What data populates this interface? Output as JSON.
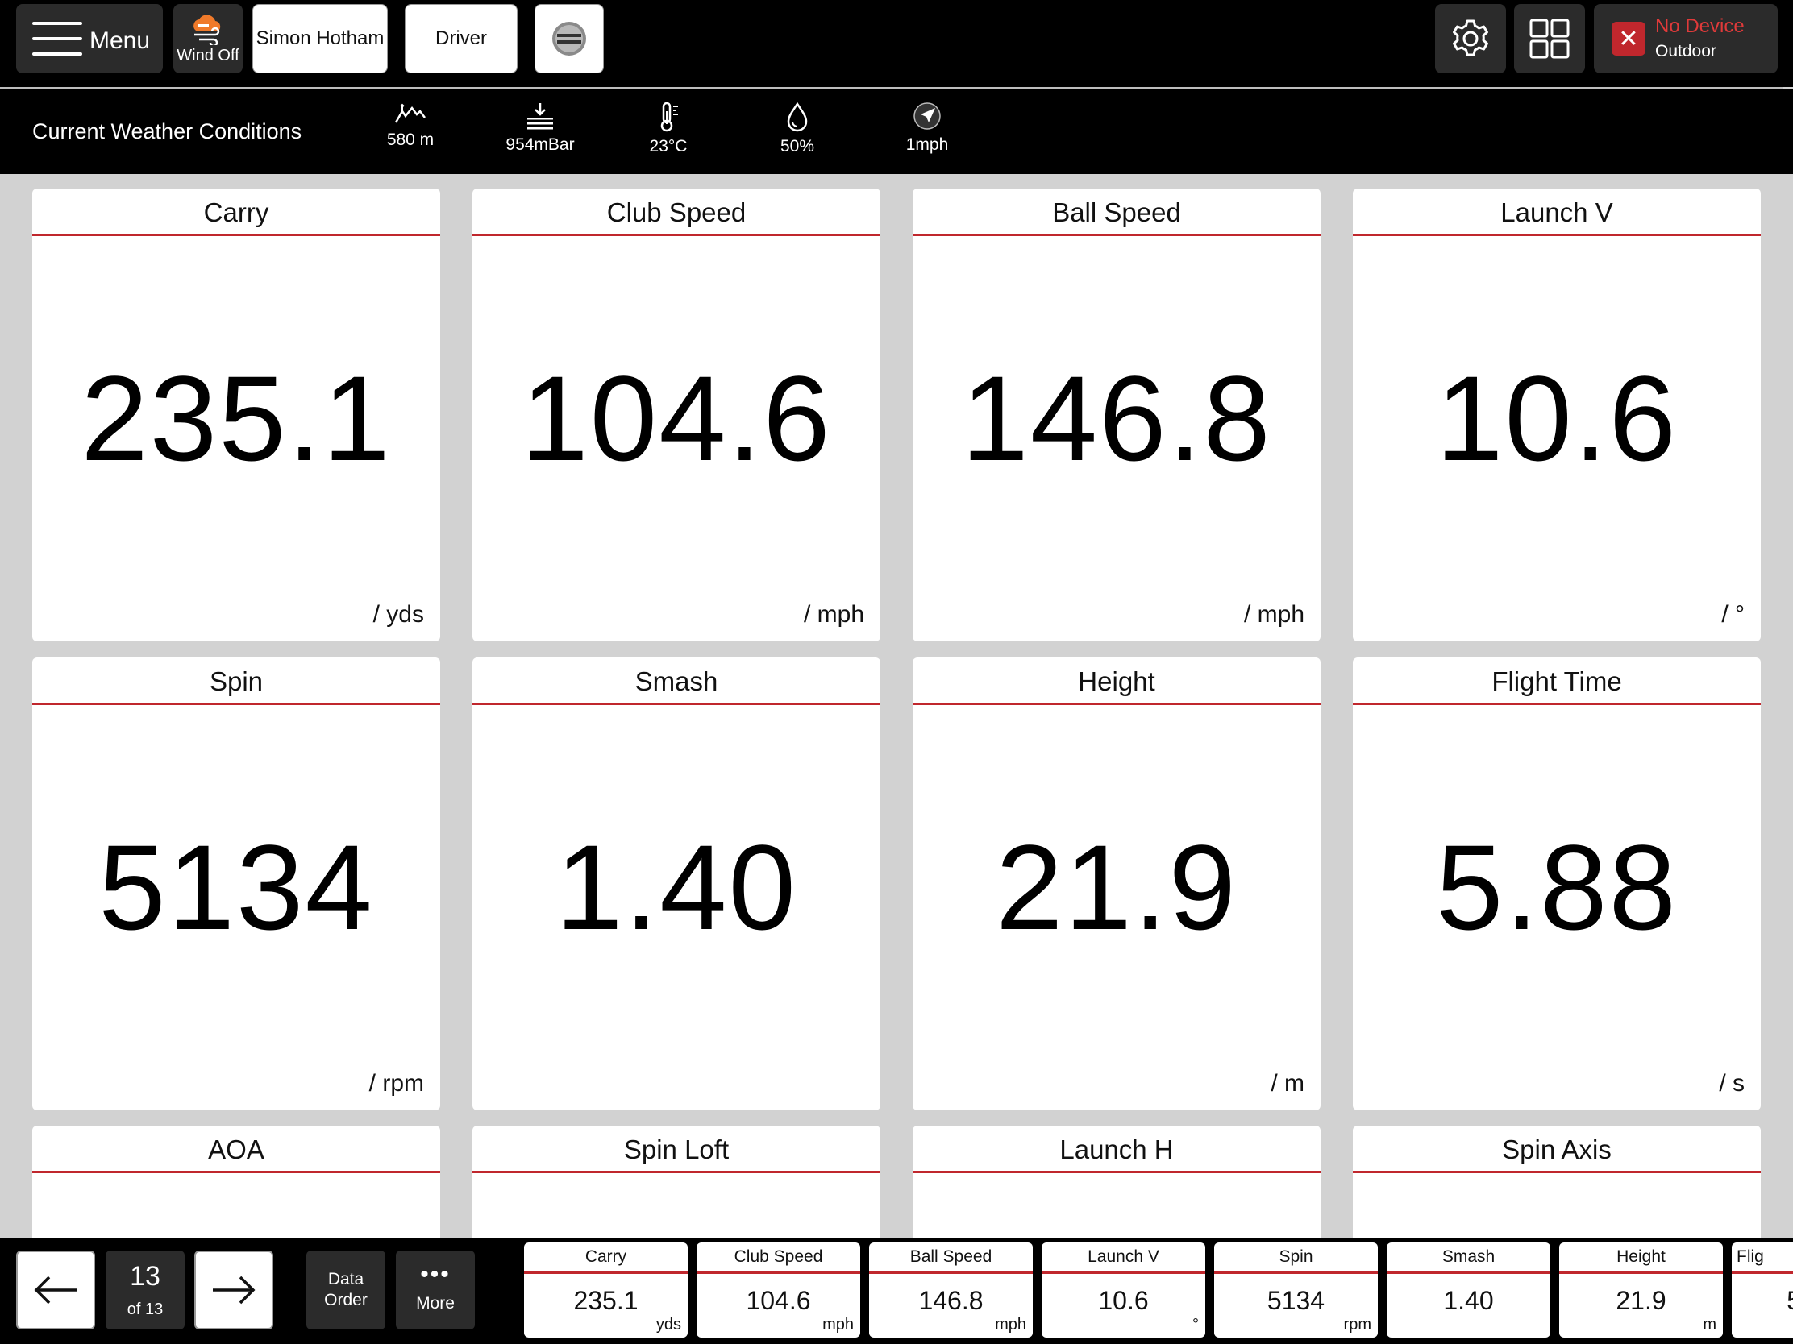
{
  "toolbar": {
    "menu_label": "Menu",
    "wind_label": "Wind Off",
    "player_name": "Simon Hotham",
    "club": "Driver",
    "device_status": "No Device",
    "device_mode": "Outdoor",
    "icons": [
      "hamburger-icon",
      "wind-cloud-icon",
      "golf-ball-icon",
      "gear-icon",
      "grid-layout-icon",
      "close-icon"
    ]
  },
  "weather": {
    "title": "Current Weather Conditions",
    "altitude": "580 m",
    "pressure": "954mBar",
    "temperature": "23°C",
    "humidity": "50%",
    "wind": "1mph"
  },
  "metrics": [
    {
      "label": "Carry",
      "value": "235.1",
      "unit": "/ yds"
    },
    {
      "label": "Club Speed",
      "value": "104.6",
      "unit": "/ mph"
    },
    {
      "label": "Ball Speed",
      "value": "146.8",
      "unit": "/ mph"
    },
    {
      "label": "Launch V",
      "value": "10.6",
      "unit": "/ °"
    },
    {
      "label": "Spin",
      "value": "5134",
      "unit": "/ rpm"
    },
    {
      "label": "Smash",
      "value": "1.40",
      "unit": ""
    },
    {
      "label": "Height",
      "value": "21.9",
      "unit": "/ m"
    },
    {
      "label": "Flight Time",
      "value": "5.88",
      "unit": "/ s"
    },
    {
      "label": "AOA"
    },
    {
      "label": "Spin Loft"
    },
    {
      "label": "Launch H"
    },
    {
      "label": "Spin Axis"
    }
  ],
  "bottom": {
    "page_current": "13",
    "page_total": "of 13",
    "data_order_line1": "Data",
    "data_order_line2": "Order",
    "more_label": "More",
    "summary": [
      {
        "label": "Carry",
        "value": "235.1",
        "unit": "yds"
      },
      {
        "label": "Club Speed",
        "value": "104.6",
        "unit": "mph"
      },
      {
        "label": "Ball Speed",
        "value": "146.8",
        "unit": "mph"
      },
      {
        "label": "Launch V",
        "value": "10.6",
        "unit": "°"
      },
      {
        "label": "Spin",
        "value": "5134",
        "unit": "rpm"
      },
      {
        "label": "Smash",
        "value": "1.40",
        "unit": ""
      },
      {
        "label": "Height",
        "value": "21.9",
        "unit": "m"
      },
      {
        "label": "Flig",
        "value": "5",
        "unit": ""
      }
    ]
  },
  "colors": {
    "accent": "#c0272d",
    "bar": "#000000",
    "button": "#2b2b2b",
    "background": "#d2d2d2",
    "wind_icon": "#f07a2a"
  }
}
